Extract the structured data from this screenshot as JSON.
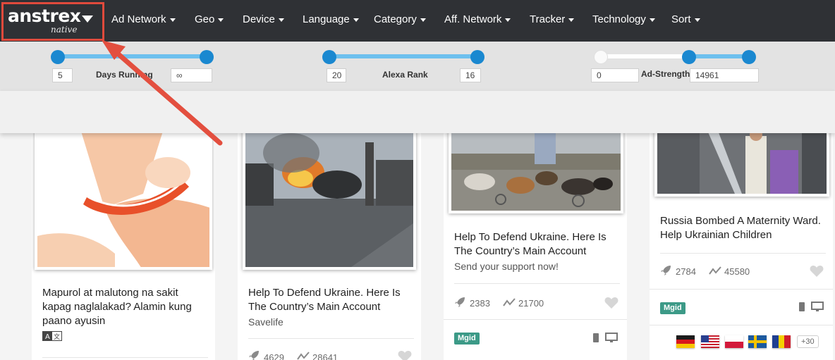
{
  "brand": {
    "name": "anstrex",
    "sub": "native"
  },
  "nav": [
    {
      "label": "Ad Network"
    },
    {
      "label": "Geo"
    },
    {
      "label": "Device"
    },
    {
      "label": "Language"
    },
    {
      "label": "Category"
    },
    {
      "label": "Aff. Network"
    },
    {
      "label": "Tracker"
    },
    {
      "label": "Technology"
    },
    {
      "label": "Sort"
    }
  ],
  "filters": {
    "days_running": {
      "label": "Days Running",
      "min": "5",
      "max": "∞"
    },
    "alexa_rank": {
      "label": "Alexa Rank",
      "min": "20",
      "max": "16"
    },
    "ad_strength": {
      "label": "Ad-Strength",
      "min": "0",
      "max": "14961"
    }
  },
  "cards": [
    {
      "title": "Mapurol at malutong na sakit kapag naglalakad? Alamin kung paano ayusin",
      "subtitle": "",
      "launches": "",
      "trend": "",
      "badge": ""
    },
    {
      "title": "Help To Defend Ukraine. Here Is The Country’s Main Account",
      "subtitle": "Savelife",
      "launches": "4629",
      "trend": "28641",
      "badge": ""
    },
    {
      "title": "Help To Defend Ukraine. Here Is The Country’s Main Account",
      "subtitle": "Send your support now!",
      "launches": "2383",
      "trend": "21700",
      "badge": "Mgid"
    },
    {
      "title": "Russia Bombed A Maternity Ward. Help Ukrainian Children",
      "subtitle": "",
      "launches": "2784",
      "trend": "45580",
      "badge": "Mgid",
      "more_geos": "+30"
    }
  ],
  "colors": {
    "navbar": "#2f3135",
    "accent": "#1a88d0",
    "badge": "#3c9a87",
    "highlight": "#e04a3c"
  }
}
